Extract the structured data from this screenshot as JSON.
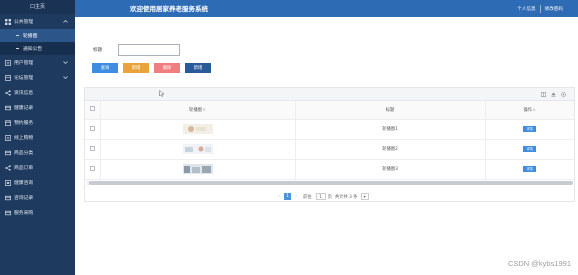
{
  "sidebar": {
    "home_label": "口主页",
    "items": [
      {
        "label": "公共管理",
        "icon": "grid-icon",
        "expanded": true
      },
      {
        "label": "用户管理",
        "icon": "user-icon",
        "expanded": false
      },
      {
        "label": "论坛管理",
        "icon": "forum-icon",
        "expanded": false
      },
      {
        "label": "资讯信息",
        "icon": "share-icon"
      },
      {
        "label": "健康记录",
        "icon": "card-icon"
      },
      {
        "label": "预约服务",
        "icon": "calendar-icon"
      },
      {
        "label": "线上购物",
        "icon": "cart-icon"
      },
      {
        "label": "商品分类",
        "icon": "tag-icon"
      },
      {
        "label": "商品订单",
        "icon": "share-icon"
      },
      {
        "label": "健康咨询",
        "icon": "chat-icon"
      },
      {
        "label": "咨询记录",
        "icon": "card-icon"
      },
      {
        "label": "服务采购",
        "icon": "card-icon"
      }
    ],
    "sub_items": [
      {
        "label": "轮播图",
        "active": true
      },
      {
        "label": "通知公告",
        "active": false
      }
    ]
  },
  "topbar": {
    "title": "欢迎使用居家养老服务系统",
    "personal_info": "个人信息",
    "change_password": "修改密码"
  },
  "search": {
    "label": "标题",
    "value": "",
    "placeholder": ""
  },
  "buttons": {
    "query": "查询",
    "add": "新增",
    "delete": "删除",
    "create": "新增"
  },
  "table": {
    "columns": [
      "轮播图",
      "标题",
      "操作"
    ],
    "rows": [
      {
        "title": "轮播图1",
        "action": "详情"
      },
      {
        "title": "轮播图2",
        "action": "详情"
      },
      {
        "title": "轮播图3",
        "action": "详情"
      }
    ]
  },
  "pager": {
    "prev": "‹",
    "current_page": "1",
    "next": "›",
    "goto_label": "前往",
    "goto_value": "1",
    "page_unit": "页",
    "total_text": "共计共 3 条",
    "page_size": "▾"
  },
  "watermark": "CSDN @kybs1991",
  "colors": {
    "sidebar_bg": "#1f3a5f",
    "topbar_bg": "#2e6bb5",
    "query_btn": "#3e8de0",
    "add_btn": "#e8a33d",
    "delete_btn": "#f07e7e",
    "create_btn": "#2a5a98"
  }
}
